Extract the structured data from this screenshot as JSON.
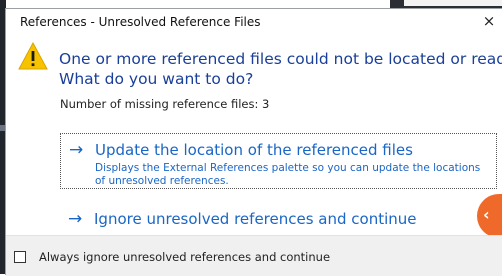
{
  "window": {
    "title": "References - Unresolved Reference Files",
    "close_glyph": "×"
  },
  "message": {
    "line1": "One or more referenced files could not be located or read.",
    "line2": "What do you want to do?",
    "icon": "warning-icon"
  },
  "missing_count_text": "Number of missing reference files: 3",
  "options": [
    {
      "label": "Update the location of the referenced files",
      "description": "Displays the External References palette so you can update the locations of unresolved references.",
      "icon": "arrow-right-icon"
    },
    {
      "label": "Ignore unresolved references and continue",
      "icon": "arrow-right-icon"
    }
  ],
  "footer": {
    "checkbox_label": "Always ignore unresolved references and continue",
    "checked": false
  },
  "colors": {
    "heading": "#1a3f9a",
    "link": "#1a66c6",
    "footer_bg": "#f0f0f0",
    "accent_orange": "#ef6a2a"
  }
}
